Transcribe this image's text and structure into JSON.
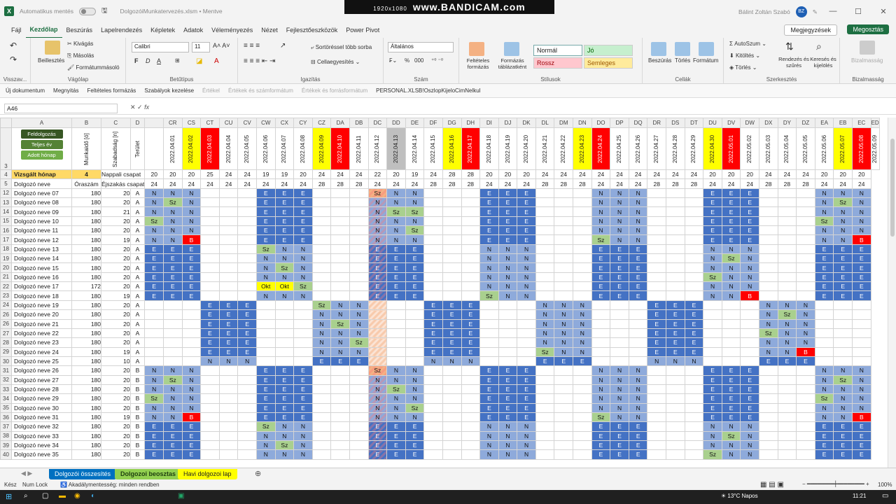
{
  "titlebar": {
    "autosave": "Automatikus mentés",
    "filename": "DolgozóiMunkatervezés.xlsm • Mentve",
    "user": "Bálint Zoltán Szabó",
    "initials": "BZ"
  },
  "bandicam": {
    "resolution": "1920x1080",
    "brand": "www.BANDICAM.com"
  },
  "menu": [
    "Fájl",
    "Kezdőlap",
    "Beszúrás",
    "Lapelrendezés",
    "Képletek",
    "Adatok",
    "Véleményezés",
    "Nézet",
    "Fejlesztőeszközök",
    "Power Pivot"
  ],
  "menu_active": "Kezdőlap",
  "comments_btn": "Megjegyzések",
  "share_btn": "Megosztás",
  "ribbon": {
    "undo_label": "Visszav...",
    "clipboard": {
      "paste": "Beillesztés",
      "cut": "Kivágás",
      "copy": "Másolás",
      "format_painter": "Formátummásoló",
      "label": "Vágólap"
    },
    "font": {
      "name": "Calibri",
      "size": "11",
      "label": "Betűtípus",
      "bold": "F",
      "italic": "D",
      "underline": "A"
    },
    "align": {
      "label": "Igazítás",
      "wrap": "Sortöréssel több sorba",
      "merge": "Cellaegyesítés"
    },
    "number": {
      "format": "Általános",
      "label": "Szám",
      "percent": "%",
      "thousands": "000"
    },
    "styles": {
      "cond": "Feltételes formázás",
      "table": "Formázás táblázatként",
      "normal": "Normál",
      "good": "Jó",
      "bad": "Rossz",
      "neutral": "Semleges",
      "label": "Stílusok"
    },
    "cells": {
      "insert": "Beszúrás",
      "delete": "Törlés",
      "format": "Formátum",
      "label": "Cellák"
    },
    "editing": {
      "autosum": "AutoSzum",
      "fill": "Kitöltés",
      "clear": "Törlés",
      "sort": "Rendezés és szűrés",
      "find": "Keresés és kijelölés",
      "label": "Szerkesztés"
    },
    "sensitivity": {
      "btn": "Bizalmasság",
      "label": "Bizalmasság"
    }
  },
  "qat": [
    "Új dokumentum",
    "Megnyitás",
    "Feltételes formázás",
    "Szabályok kezelése",
    "Értékel",
    "Értékek és számformátum",
    "Értékek és forrásformátum",
    "PERSONAL.XLSB!OszlopKijeloCimNelkul"
  ],
  "formula": {
    "namebox": "A46",
    "fx": "fx"
  },
  "sheet": {
    "col_letters": [
      "A",
      "B",
      "C",
      "D",
      "CR",
      "CS",
      "CT",
      "CU",
      "CV",
      "CW",
      "CX",
      "CY",
      "CZ",
      "DA",
      "DB",
      "DC",
      "DD",
      "DE",
      "DF",
      "DG",
      "DH",
      "DI",
      "DJ",
      "DK",
      "DL",
      "DM",
      "DN",
      "DO",
      "DP",
      "DQ",
      "DR",
      "DS",
      "DT",
      "DU",
      "DV",
      "DW",
      "DX",
      "DY",
      "DZ",
      "EA",
      "EB",
      "EC",
      "ED"
    ],
    "buttons": [
      "Feldolgozás",
      "Teljes év",
      "Adott hónap"
    ],
    "header_b": "Munkaidő [ó]",
    "header_c": "Szabadság [n]",
    "header_d": "Terület",
    "row4_label": "Vizsgált hónap",
    "row4_value": "4",
    "row4_c": "Nappali csapat",
    "row5_a": "Dolgozó neve",
    "row5_b": "Óraszám",
    "row5_c": "Éjszakás csapat",
    "dates": [
      "2022.04.01",
      "2022.04.02",
      "2022.04.03",
      "2022.04.04",
      "2022.04.05",
      "2022.04.06",
      "2022.04.07",
      "2022.04.08",
      "2022.04.09",
      "2022.04.10",
      "2022.04.11",
      "2022.04.12",
      "2022.04.13",
      "2022.04.14",
      "2022.04.15",
      "2022.04.16",
      "2022.04.17",
      "2022.04.18",
      "2022.04.19",
      "2022.04.20",
      "2022.04.21",
      "2022.04.22",
      "2022.04.23",
      "2022.04.24",
      "2022.04.25",
      "2022.04.26",
      "2022.04.27",
      "2022.04.28",
      "2022.04.29",
      "2022.04.30",
      "2022.05.01",
      "2022.05.02",
      "2022.05.03",
      "2022.05.04",
      "2022.05.05",
      "2022.05.06",
      "2022.05.07",
      "2022.05.08",
      "2022.05.09"
    ],
    "date_colors": [
      "w",
      "y",
      "r",
      "w",
      "w",
      "w",
      "w",
      "w",
      "y",
      "r",
      "w",
      "w",
      "g",
      "w",
      "w",
      "y",
      "r",
      "w",
      "w",
      "w",
      "w",
      "w",
      "y",
      "r",
      "w",
      "w",
      "w",
      "w",
      "w",
      "y",
      "r",
      "w",
      "w",
      "w",
      "w",
      "w",
      "y",
      "r",
      "w"
    ],
    "row4_vals": [
      "20",
      "20",
      "20",
      "25",
      "24",
      "24",
      "19",
      "19",
      "20",
      "24",
      "24",
      "24",
      "22",
      "20",
      "19",
      "24",
      "28",
      "28",
      "20",
      "20",
      "20",
      "24",
      "24",
      "24",
      "24",
      "24",
      "24",
      "24",
      "24",
      "24",
      "20",
      "20",
      "20",
      "24",
      "24",
      "24",
      "20",
      "20",
      "20"
    ],
    "row5_vals": [
      "24",
      "24",
      "24",
      "24",
      "24",
      "24",
      "24",
      "24",
      "24",
      "28",
      "28",
      "28",
      "24",
      "24",
      "24",
      "28",
      "28",
      "28",
      "24",
      "24",
      "24",
      "28",
      "28",
      "28",
      "24",
      "24",
      "24",
      "28",
      "28",
      "28",
      "24",
      "24",
      "24",
      "28",
      "28",
      "28",
      "24",
      "24",
      "24"
    ],
    "rows": [
      {
        "n": "12",
        "name": "Dolgozó neve 07",
        "h": "180",
        "s": "20",
        "t": "A",
        "c": "N N N _ _ _ E E E _ _ _ Sz! N N _ _ _ E E E _ _ _ N N N _ _ _ E E E _ _ _ N N N"
      },
      {
        "n": "13",
        "name": "Dolgozó neve 08",
        "h": "180",
        "s": "20",
        "t": "A",
        "c": "N Sz N _ _ _ E E E _ _ _ N N N _ _ _ E E E _ _ _ N N N _ _ _ E E E _ _ _ N Sz N"
      },
      {
        "n": "14",
        "name": "Dolgozó neve 09",
        "h": "180",
        "s": "21",
        "t": "A",
        "c": "N N N _ _ _ E E E _ _ _ N Sz Sz _ _ _ E E E _ _ _ N N N _ _ _ E E E _ _ _ N N N"
      },
      {
        "n": "15",
        "name": "Dolgozó neve 10",
        "h": "180",
        "s": "20",
        "t": "A",
        "c": "Sz N N _ _ _ E E E _ _ _ N N N _ _ _ E E E _ _ _ N N N _ _ _ E E E _ _ _ Sz N N"
      },
      {
        "n": "16",
        "name": "Dolgozó neve 11",
        "h": "180",
        "s": "20",
        "t": "A",
        "c": "N N N _ _ _ E E E _ _ _ N N Sz _ _ _ E E E _ _ _ N N N _ _ _ E E E _ _ _ N N N"
      },
      {
        "n": "17",
        "name": "Dolgozó neve 12",
        "h": "180",
        "s": "19",
        "t": "A",
        "c": "N N B _ _ _ E E E _ _ _ N N N _ _ _ E E E _ _ _ Sz N N _ _ _ E E E _ _ _ N N B"
      },
      {
        "n": "18",
        "name": "Dolgozó neve 13",
        "h": "180",
        "s": "20",
        "t": "A",
        "c": "E E E _ _ _ Sz N N _ _ _ E E E _ _ _ N N N _ _ _ E E E _ _ _ N N N _ _ _ E E E"
      },
      {
        "n": "19",
        "name": "Dolgozó neve 14",
        "h": "180",
        "s": "20",
        "t": "A",
        "c": "E E E _ _ _ N N N _ _ _ E E E _ _ _ N N N _ _ _ E E E _ _ _ N Sz N _ _ _ E E E"
      },
      {
        "n": "20",
        "name": "Dolgozó neve 15",
        "h": "180",
        "s": "20",
        "t": "A",
        "c": "E E E _ _ _ N Sz N _ _ _ E E E _ _ _ N N N _ _ _ E E E _ _ _ N N N _ _ _ E E E"
      },
      {
        "n": "21",
        "name": "Dolgozó neve 16",
        "h": "180",
        "s": "20",
        "t": "A",
        "c": "E E E _ _ _ N N N _ _ _ E E E _ _ _ N N N _ _ _ E E E _ _ _ Sz N N _ _ _ E E E"
      },
      {
        "n": "22",
        "name": "Dolgozó neve 17",
        "h": "172",
        "s": "20",
        "t": "A",
        "c": "E E E _ _ _ Okt Okt Sz _ _ _ E E E _ _ _ N N N _ _ _ E E E _ _ _ N N N _ _ _ E E E"
      },
      {
        "n": "23",
        "name": "Dolgozó neve 18",
        "h": "180",
        "s": "19",
        "t": "A",
        "c": "E E E _ _ _ N N N _ _ _ E E E _ _ _ Sz N N _ _ _ E E E _ _ _ N N B _ _ _ E E E"
      },
      {
        "n": "24",
        "name": "Dolgozó neve 19",
        "h": "180",
        "s": "20",
        "t": "A",
        "c": "_ _ _ E E E _ _ _ Sz N N _ _ _ E E E _ _ _ N N N _ _ _ E E E _ _ _ N N N _ _ _"
      },
      {
        "n": "26",
        "name": "Dolgozó neve 20",
        "h": "180",
        "s": "20",
        "t": "A",
        "c": "_ _ _ E E E _ _ _ N N N _ _ _ E E E _ _ _ N N N _ _ _ E E E _ _ _ N Sz N _ _ _"
      },
      {
        "n": "26",
        "name": "Dolgozó neve 21",
        "h": "180",
        "s": "20",
        "t": "A",
        "c": "_ _ _ E E E _ _ _ N Sz N _ _ _ E E E _ _ _ N N N _ _ _ E E E _ _ _ N N N _ _ _"
      },
      {
        "n": "27",
        "name": "Dolgozó neve 22",
        "h": "180",
        "s": "20",
        "t": "A",
        "c": "_ _ _ E E E _ _ _ N N N _ _ _ E E E _ _ _ N N N _ _ _ E E E _ _ _ Sz N N _ _ _"
      },
      {
        "n": "28",
        "name": "Dolgozó neve 23",
        "h": "180",
        "s": "20",
        "t": "A",
        "c": "_ _ _ E E E _ _ _ N N Sz _ _ _ E E E _ _ _ N N N _ _ _ E E E _ _ _ N N N _ _ _"
      },
      {
        "n": "29",
        "name": "Dolgozó neve 24",
        "h": "180",
        "s": "19",
        "t": "A",
        "c": "_ _ _ E E E _ _ _ N N N _ _ _ E E E _ _ _ Sz N N _ _ _ E E E _ _ _ N N B _ _ _"
      },
      {
        "n": "30",
        "name": "Dolgozó neve 25",
        "h": "180",
        "s": "10",
        "t": "A",
        "c": "_ _ _ N N N _ _ _ E E E _ _ _ N N N _ _ _ E E E _ _ _ N N N _ _ _ E E E _ _ _"
      },
      {
        "n": "31",
        "name": "Dolgozó neve 26",
        "h": "180",
        "s": "20",
        "t": "B",
        "c": "N N N _ _ _ E E E _ _ _ Sz! N N _ _ _ E E E _ _ _ N N N _ _ _ E E E _ _ _ N N N"
      },
      {
        "n": "32",
        "name": "Dolgozó neve 27",
        "h": "180",
        "s": "20",
        "t": "B",
        "c": "N Sz N _ _ _ E E E _ _ _ N N N _ _ _ E E E _ _ _ N N N _ _ _ E E E _ _ _ N Sz N"
      },
      {
        "n": "33",
        "name": "Dolgozó neve 28",
        "h": "180",
        "s": "20",
        "t": "B",
        "c": "N N N _ _ _ E E E _ _ _ N Sz N _ _ _ E E E _ _ _ N N N _ _ _ E E E _ _ _ N N N"
      },
      {
        "n": "34",
        "name": "Dolgozó neve 29",
        "h": "180",
        "s": "20",
        "t": "B",
        "c": "Sz N N _ _ _ E E E _ _ _ N N N _ _ _ E E E _ _ _ N N N _ _ _ E E E _ _ _ Sz N N"
      },
      {
        "n": "35",
        "name": "Dolgozó neve 30",
        "h": "180",
        "s": "20",
        "t": "B",
        "c": "N N N _ _ _ E E E _ _ _ N N Sz _ _ _ E E E _ _ _ N N N _ _ _ E E E _ _ _ N N N"
      },
      {
        "n": "36",
        "name": "Dolgozó neve 31",
        "h": "180",
        "s": "19",
        "t": "B",
        "c": "N N B _ _ _ E E E _ _ _ N N N _ _ _ E E E _ _ _ Sz N N _ _ _ E E E _ _ _ N N B"
      },
      {
        "n": "37",
        "name": "Dolgozó neve 32",
        "h": "180",
        "s": "20",
        "t": "B",
        "c": "E E E _ _ _ Sz N N _ _ _ E E E _ _ _ N N N _ _ _ E E E _ _ _ N N N _ _ _ E E E"
      },
      {
        "n": "38",
        "name": "Dolgozó neve 33",
        "h": "180",
        "s": "20",
        "t": "B",
        "c": "E E E _ _ _ N N N _ _ _ E E E _ _ _ N N N _ _ _ E E E _ _ _ N Sz N _ _ _ E E E"
      },
      {
        "n": "39",
        "name": "Dolgozó neve 34",
        "h": "180",
        "s": "20",
        "t": "B",
        "c": "E E E _ _ _ N Sz N _ _ _ E E E _ _ _ N N N _ _ _ E E E _ _ _ N N N _ _ _ E E E"
      },
      {
        "n": "40",
        "name": "Dolgozó neve 35",
        "h": "180",
        "s": "20",
        "t": "B",
        "c": "E E E _ _ _ N N N _ _ _ E E E _ _ _ N N N _ _ _ E E E _ _ _ Sz N N _ _ _ E E E"
      }
    ]
  },
  "sheet_tabs": [
    {
      "label": "Dolgozói összesítés",
      "color": "#0070c0",
      "fg": "#fff"
    },
    {
      "label": "Dolgozoi beosztas",
      "color": "#92d050",
      "fg": "#1d3d10"
    },
    {
      "label": "Havi dolgozoi lap",
      "color": "#ffff00",
      "fg": "#222"
    }
  ],
  "status": {
    "ready": "Kész",
    "numlock": "Num Lock",
    "access": "Akadálymentesség: minden rendben",
    "zoom": "100%"
  },
  "taskbar": {
    "weather": "13°C Napos",
    "time": "11:21"
  }
}
